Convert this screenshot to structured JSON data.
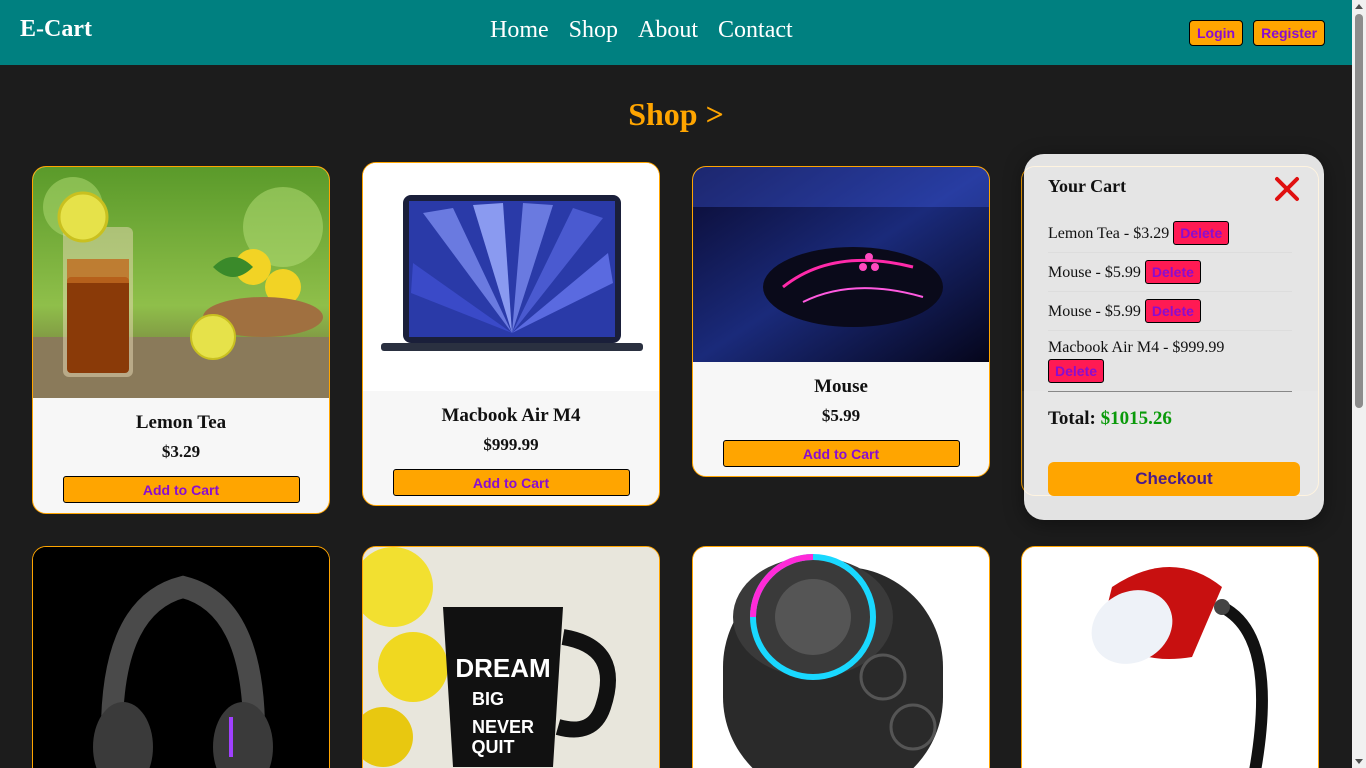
{
  "nav": {
    "brand": "E-Cart",
    "links": [
      "Home",
      "Shop",
      "About",
      "Contact"
    ],
    "login": "Login",
    "register": "Register"
  },
  "shop_heading": "Shop >",
  "products": [
    {
      "name": "Lemon Tea",
      "price": "$3.29",
      "button": "Add to Cart",
      "image": "lemon-tea-photo"
    },
    {
      "name": "Macbook Air M4",
      "price": "$999.99",
      "button": "Add to Cart",
      "image": "laptop-photo"
    },
    {
      "name": "Mouse",
      "price": "$5.99",
      "button": "Add to Cart",
      "image": "gaming-mouse-photo"
    },
    {
      "name": "",
      "price": "",
      "button": "",
      "image": "hidden-product-photo"
    },
    {
      "name": "",
      "price": "",
      "button": "",
      "image": "headphones-photo"
    },
    {
      "name": "",
      "price": "",
      "button": "",
      "image": "dream-big-mug-photo"
    },
    {
      "name": "",
      "price": "",
      "button": "",
      "image": "bluetooth-speaker-photo"
    },
    {
      "name": "",
      "price": "",
      "button": "",
      "image": "desk-lamp-photo"
    }
  ],
  "cart": {
    "title": "Your Cart",
    "items": [
      {
        "text": "Lemon Tea - $3.29",
        "delete": "Delete"
      },
      {
        "text": "Mouse - $5.99",
        "delete": "Delete"
      },
      {
        "text": "Mouse - $5.99",
        "delete": "Delete"
      },
      {
        "text": "Macbook Air M4 - $999.99",
        "delete": "Delete"
      }
    ],
    "total_label": "Total:",
    "total_value": "$1015.26",
    "checkout": "Checkout"
  },
  "colors": {
    "navbar": "#008080",
    "accent": "#ffa500",
    "background": "#1c1c1c",
    "button_text": "#8a0dd0",
    "delete_bg": "#ff1a53",
    "total_green": "#0a9a0a"
  }
}
